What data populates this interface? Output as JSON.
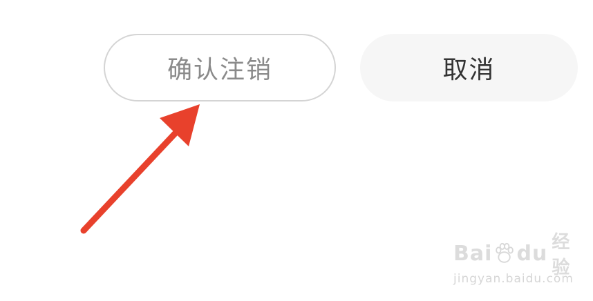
{
  "dialog": {
    "confirm_label": "确认注销",
    "cancel_label": "取消"
  },
  "annotation": {
    "arrow_color": "#e8412c"
  },
  "watermark": {
    "brand_left": "Bai",
    "brand_right": "du",
    "service": "经验",
    "url": "jingyan.baidu.com"
  },
  "colors": {
    "confirm_border": "#d4d4d4",
    "confirm_text": "#8a8a8a",
    "cancel_bg": "#f6f6f6",
    "cancel_text": "#333333"
  }
}
